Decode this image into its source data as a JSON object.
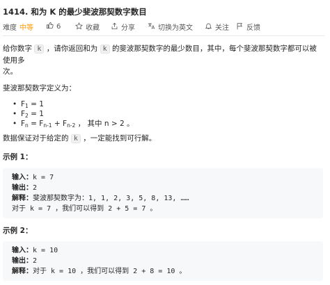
{
  "problem": {
    "title": "1414. 和为 K 的最少斐波那契数字数目"
  },
  "toolbar": {
    "difficulty_label": "难度",
    "difficulty_value": "中等",
    "likes": "6",
    "favorite": "收藏",
    "share": "分享",
    "switch_lang": "切换为英文",
    "follow": "关注",
    "feedback": "反馈"
  },
  "description": {
    "p1_a": "给你数字",
    "p1_code": "k",
    "p1_b": "，请你返回和为",
    "p1_code2": "k",
    "p1_c": "的斐波那契数字的最少数目，其中，每个斐波那契数字都可以被使用多",
    "p1_d": "次。",
    "p2": "斐波那契数字定义为：",
    "fib": [
      {
        "f": "F",
        "sub": "1",
        "rest": " = 1"
      },
      {
        "f": "F",
        "sub": "2",
        "rest": " = 1"
      },
      {
        "f": "F",
        "sub": "n",
        "rest": " = F",
        "sub2": "n-1",
        "rest2": " + F",
        "sub3": "n-2",
        "rest3": " ， 其中 n > 2 。"
      }
    ],
    "p3_a": "数据保证对于给定的",
    "p3_code": "k",
    "p3_b": "，一定能找到可行解。"
  },
  "example1": {
    "title": "示例 1：",
    "input_label": "输入：",
    "input_value": "k = 7",
    "output_label": "输出：",
    "output_value": "2",
    "explain_label": "解释：",
    "explain_value": "斐波那契数字为：1, 1, 2, 3, 5, 8, 13, ……",
    "explain_value2": "对于 k = 7 ，我们可以得到 2 + 5 = 7 。"
  },
  "example2": {
    "title": "示例 2：",
    "input_label": "输入：",
    "input_value": "k = 10",
    "output_label": "输出：",
    "output_value": "2",
    "explain_label": "解释：",
    "explain_value": "对于 k = 10 ，我们可以得到 2 + 8 = 10 。"
  },
  "colors": {
    "difficulty_medium": "#ff9800",
    "code_bg": "#f7f8fa"
  }
}
